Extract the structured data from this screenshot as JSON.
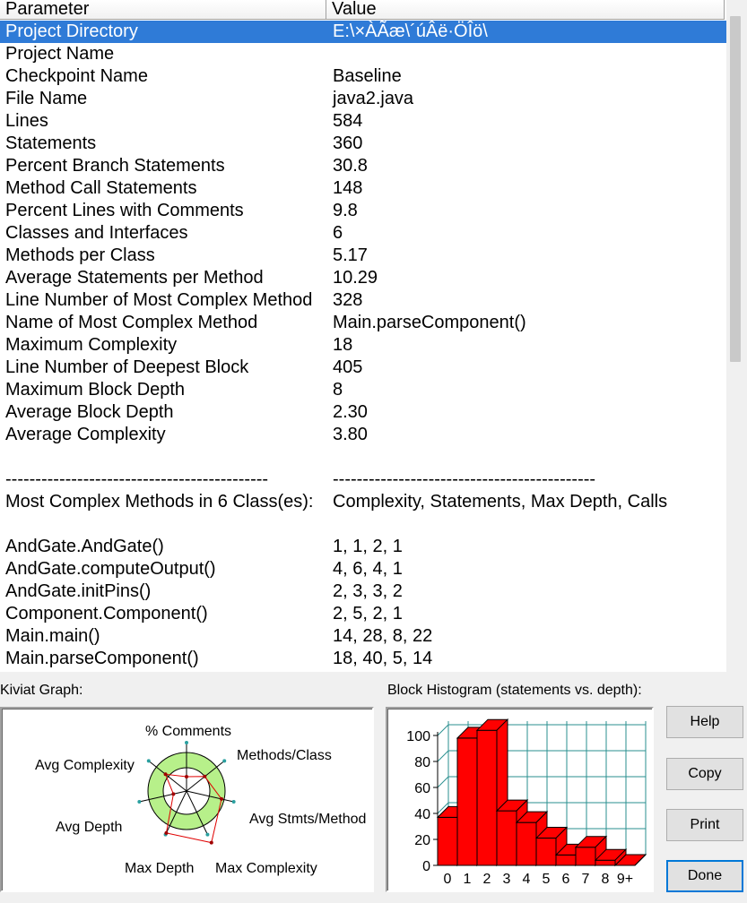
{
  "table": {
    "headers": {
      "parameter": "Parameter",
      "value": "Value"
    },
    "rows": [
      {
        "p": "Project Directory",
        "v": "E:\\×ÀÃæ\\´úÂë·ÖÎö\\"
      },
      {
        "p": "Project Name",
        "v": ""
      },
      {
        "p": "Checkpoint Name",
        "v": "Baseline"
      },
      {
        "p": "File Name",
        "v": "java2.java"
      },
      {
        "p": "Lines",
        "v": "584"
      },
      {
        "p": "Statements",
        "v": "360"
      },
      {
        "p": "Percent Branch Statements",
        "v": "30.8"
      },
      {
        "p": "Method Call Statements",
        "v": "148"
      },
      {
        "p": "Percent Lines with Comments",
        "v": "9.8"
      },
      {
        "p": "Classes and Interfaces",
        "v": "6"
      },
      {
        "p": "Methods per Class",
        "v": "5.17"
      },
      {
        "p": "Average Statements per Method",
        "v": "10.29"
      },
      {
        "p": "Line Number of Most Complex Method",
        "v": "328"
      },
      {
        "p": "Name of Most Complex Method",
        "v": "Main.parseComponent()"
      },
      {
        "p": "Maximum Complexity",
        "v": "18"
      },
      {
        "p": "Line Number of Deepest Block",
        "v": "405"
      },
      {
        "p": "Maximum Block Depth",
        "v": "8"
      },
      {
        "p": "Average Block Depth",
        "v": "2.30"
      },
      {
        "p": "Average Complexity",
        "v": "3.80"
      },
      {
        "p": "",
        "v": ""
      },
      {
        "p": "--------------------------------------------",
        "v": "--------------------------------------------"
      },
      {
        "p": "Most Complex Methods in 6 Class(es):",
        "v": "Complexity, Statements, Max Depth, Calls"
      },
      {
        "p": "",
        "v": ""
      },
      {
        "p": "AndGate.AndGate()",
        "v": "1, 1, 2, 1"
      },
      {
        "p": "AndGate.computeOutput()",
        "v": "4, 6, 4, 1"
      },
      {
        "p": "AndGate.initPins()",
        "v": "2, 3, 3, 2"
      },
      {
        "p": "Component.Component()",
        "v": "2, 5, 2, 1"
      },
      {
        "p": "Main.main()",
        "v": "14, 28, 8, 22"
      },
      {
        "p": "Main.parseComponent()",
        "v": "18, 40, 5, 14"
      }
    ],
    "selected_index": 0,
    "selection_color": "#2f7bd7"
  },
  "kiviat": {
    "title": "Kiviat Graph:",
    "axes": [
      "% Comments",
      "Methods/Class",
      "Avg Stmts/Method",
      "Max Complexity",
      "Max Depth",
      "Avg Depth",
      "Avg Complexity"
    ],
    "band_color": "#b7f08a"
  },
  "histogram": {
    "title": "Block Histogram (statements vs. depth):",
    "bar_color": "#ff0000"
  },
  "buttons": {
    "help": "Help",
    "copy": "Copy",
    "print": "Print",
    "done": "Done"
  },
  "chart_data": {
    "type": "bar",
    "categories": [
      "0",
      "1",
      "2",
      "3",
      "4",
      "5",
      "6",
      "7",
      "8",
      "9+"
    ],
    "values": [
      37,
      98,
      104,
      42,
      33,
      21,
      8,
      14,
      4,
      0
    ],
    "ylim": [
      0,
      100
    ],
    "yticks": [
      0,
      20,
      40,
      60,
      80,
      100
    ],
    "xlabel": "",
    "ylabel": ""
  }
}
